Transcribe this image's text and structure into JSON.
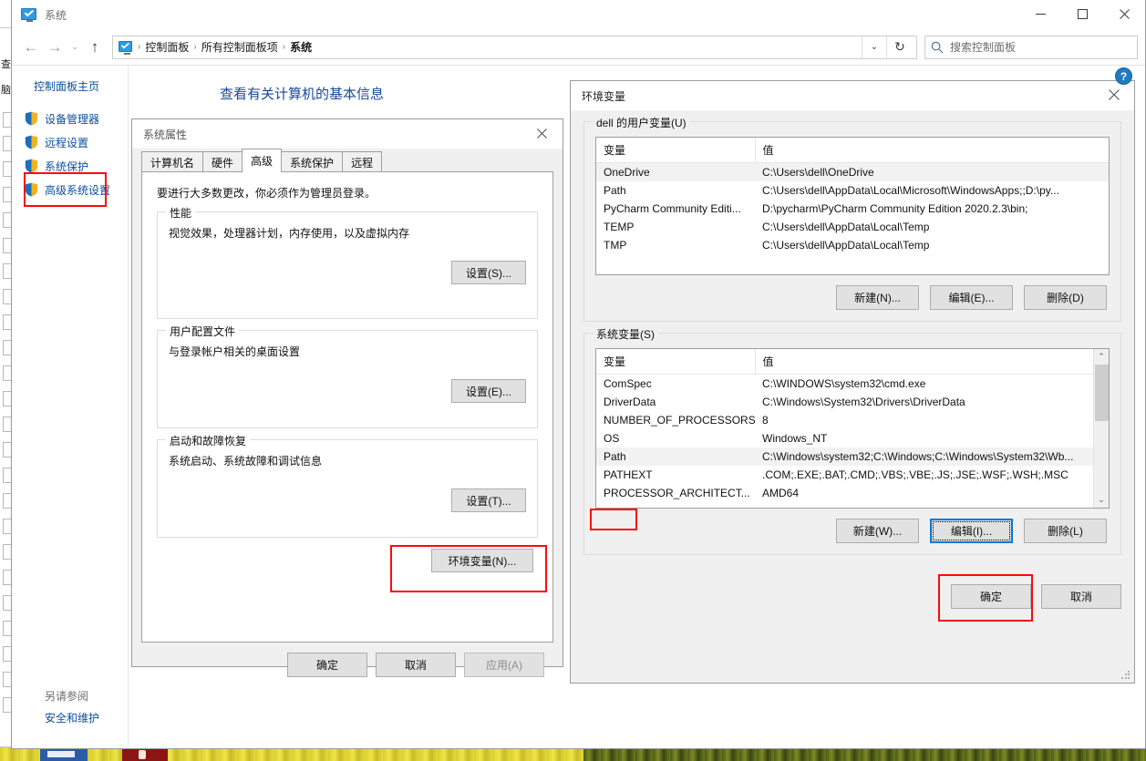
{
  "window": {
    "title": "系统",
    "minimize_label": "—",
    "maximize_label": "▢",
    "close_label": "✕"
  },
  "addressbar": {
    "back_label": "←",
    "forward_label": "→",
    "recent_label": "⌄",
    "up_label": "↑",
    "crumbs": [
      "控制面板",
      "所有控制面板项",
      "系统"
    ],
    "separator": "›",
    "dropdown_label": "⌄",
    "refresh_label": "↻",
    "search_placeholder": "搜索控制面板"
  },
  "sidebar": {
    "home_label": "控制面板主页",
    "items": [
      {
        "label": "设备管理器"
      },
      {
        "label": "远程设置"
      },
      {
        "label": "系统保护"
      },
      {
        "label": "高级系统设置"
      }
    ],
    "see_also_label": "另请参阅",
    "see_also_link": "安全和维护"
  },
  "main": {
    "page_title": "查看有关计算机的基本信息"
  },
  "system_properties": {
    "title": "系统属性",
    "close_label": "✕",
    "tabs": [
      {
        "label": "计算机名",
        "active": false
      },
      {
        "label": "硬件",
        "active": false
      },
      {
        "label": "高级",
        "active": true
      },
      {
        "label": "系统保护",
        "active": false
      },
      {
        "label": "远程",
        "active": false
      }
    ],
    "admin_note": "要进行大多数更改，你必须作为管理员登录。",
    "groups": [
      {
        "legend": "性能",
        "description": "视觉效果，处理器计划，内存使用，以及虚拟内存",
        "button": "设置(S)..."
      },
      {
        "legend": "用户配置文件",
        "description": "与登录帐户相关的桌面设置",
        "button": "设置(E)..."
      },
      {
        "legend": "启动和故障恢复",
        "description": "系统启动、系统故障和调试信息",
        "button": "设置(T)..."
      }
    ],
    "env_button": "环境变量(N)...",
    "footer": {
      "ok": "确定",
      "cancel": "取消",
      "apply": "应用(A)"
    }
  },
  "env_dialog": {
    "title": "环境变量",
    "close_label": "✕",
    "help_label": "?",
    "user_section": {
      "legend": "dell 的用户变量(U)",
      "columns": [
        "变量",
        "值"
      ],
      "rows": [
        {
          "name": "OneDrive",
          "value": "C:\\Users\\dell\\OneDrive",
          "selected": true
        },
        {
          "name": "Path",
          "value": "C:\\Users\\dell\\AppData\\Local\\Microsoft\\WindowsApps;;D:\\py...",
          "selected": false
        },
        {
          "name": "PyCharm Community Editi...",
          "value": "D:\\pycharm\\PyCharm Community Edition 2020.2.3\\bin;",
          "selected": false
        },
        {
          "name": "TEMP",
          "value": "C:\\Users\\dell\\AppData\\Local\\Temp",
          "selected": false
        },
        {
          "name": "TMP",
          "value": "C:\\Users\\dell\\AppData\\Local\\Temp",
          "selected": false
        }
      ],
      "buttons": {
        "new": "新建(N)...",
        "edit": "编辑(E)...",
        "delete": "删除(D)"
      }
    },
    "system_section": {
      "legend": "系统变量(S)",
      "columns": [
        "变量",
        "值"
      ],
      "rows": [
        {
          "name": "ComSpec",
          "value": "C:\\WINDOWS\\system32\\cmd.exe",
          "selected": false
        },
        {
          "name": "DriverData",
          "value": "C:\\Windows\\System32\\Drivers\\DriverData",
          "selected": false
        },
        {
          "name": "NUMBER_OF_PROCESSORS",
          "value": "8",
          "selected": false
        },
        {
          "name": "OS",
          "value": "Windows_NT",
          "selected": false
        },
        {
          "name": "Path",
          "value": "C:\\Windows\\system32;C:\\Windows;C:\\Windows\\System32\\Wb...",
          "selected": true
        },
        {
          "name": "PATHEXT",
          "value": ".COM;.EXE;.BAT;.CMD;.VBS;.VBE;.JS;.JSE;.WSF;.WSH;.MSC",
          "selected": false
        },
        {
          "name": "PROCESSOR_ARCHITECT...",
          "value": "AMD64",
          "selected": false
        }
      ],
      "scroll_up": "⌃",
      "scroll_down": "⌄",
      "buttons": {
        "new": "新建(W)...",
        "edit": "编辑(I)...",
        "delete": "删除(L)"
      }
    },
    "footer": {
      "ok": "确定",
      "cancel": "取消"
    }
  },
  "annotations": {
    "highlight_color": "#fb0b0b",
    "targets": [
      "高级系统设置",
      "环境变量(N)...",
      "Path",
      "编辑(I)..."
    ]
  }
}
